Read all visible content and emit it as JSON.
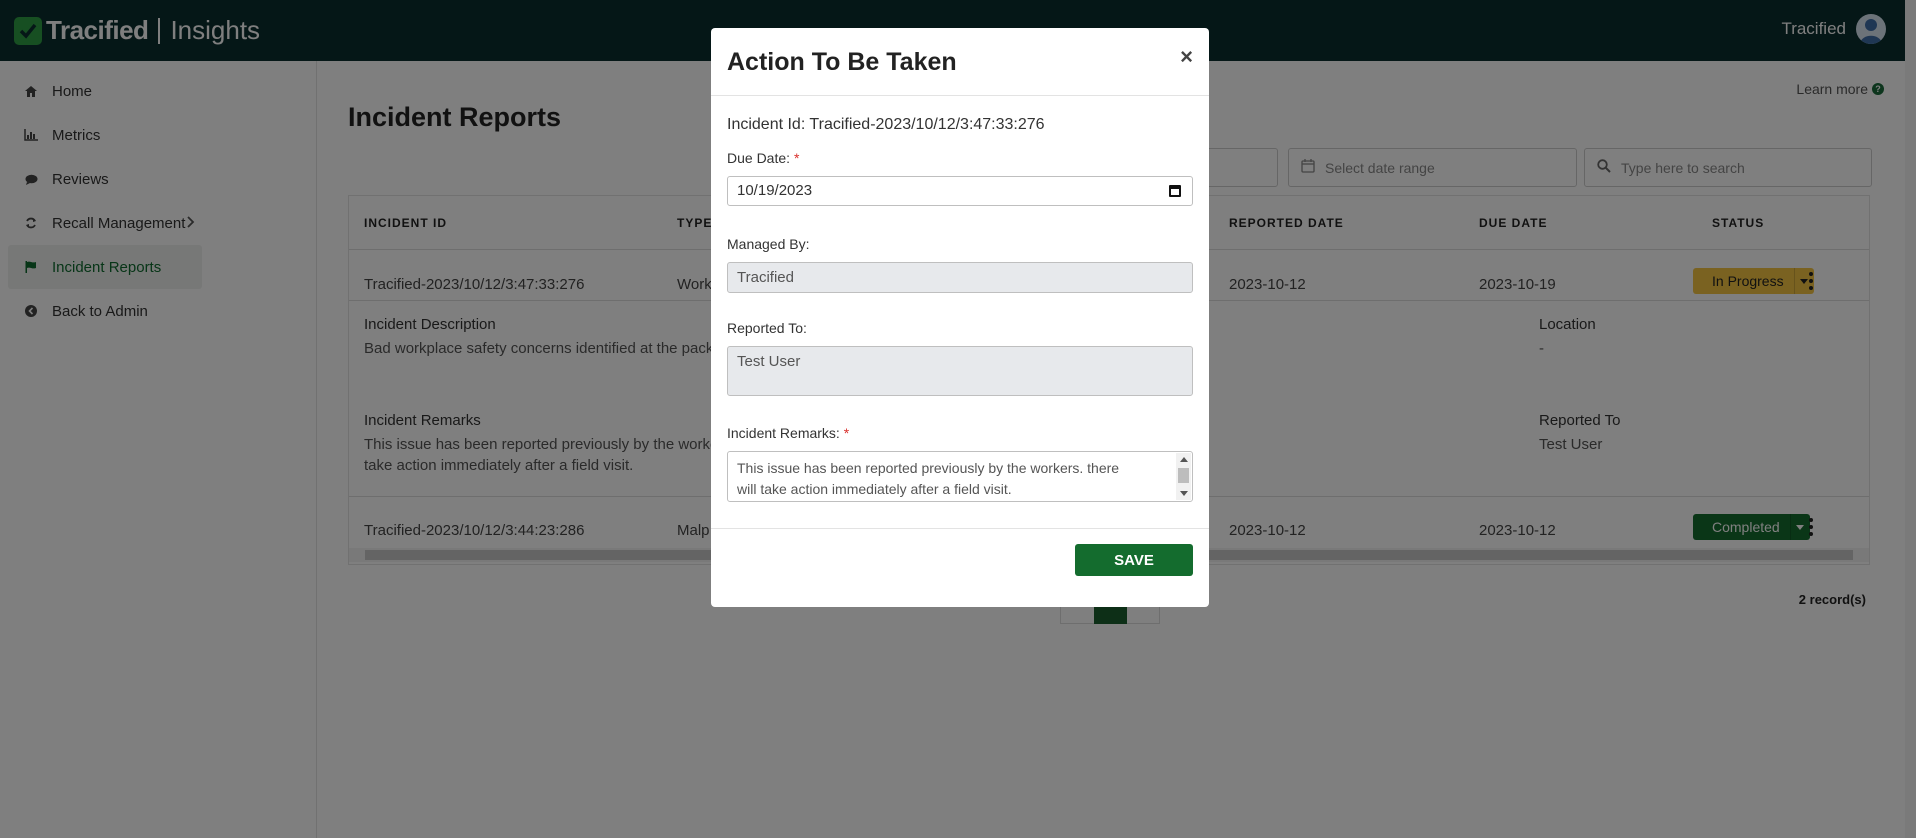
{
  "header": {
    "brand": "Tracified",
    "product": "Insights",
    "user": "Tracified"
  },
  "sidebar": {
    "items": [
      {
        "label": "Home",
        "icon": "home-icon"
      },
      {
        "label": "Metrics",
        "icon": "bar-chart-icon"
      },
      {
        "label": "Reviews",
        "icon": "comment-icon"
      },
      {
        "label": "Recall Management",
        "icon": "refresh-icon"
      },
      {
        "label": "Incident Reports",
        "icon": "flag-icon",
        "active": true
      },
      {
        "label": "Back to Admin",
        "icon": "arrow-left-circle-icon"
      }
    ]
  },
  "page": {
    "learn_more": "Learn more",
    "title": "Incident Reports",
    "date_placeholder": "Select date range",
    "search_placeholder": "Type here to search",
    "records": "2 record(s)"
  },
  "table": {
    "columns": [
      "INCIDENT ID",
      "TYPE",
      "REPORTED DATE",
      "DUE DATE",
      "STATUS"
    ],
    "rows": [
      {
        "id": "Tracified-2023/10/12/3:47:33:276",
        "type": "Work",
        "reported": "2023-10-12",
        "due": "2023-10-19",
        "status": "In Progress"
      },
      {
        "id": "Tracified-2023/10/12/3:44:23:286",
        "type": "Malp",
        "reported": "2023-10-12",
        "due": "2023-10-12",
        "status": "Completed"
      }
    ],
    "details": {
      "desc_label": "Incident Description",
      "desc_text": "Bad workplace safety concerns identified at the pack",
      "location_label": "Location",
      "location_value": "-",
      "remarks_label": "Incident Remarks",
      "remarks_text_1": "This issue has been reported previously by the worke",
      "remarks_text_2": "take action immediately after a field visit.",
      "reported_to_label": "Reported To",
      "reported_to_value": "Test User"
    }
  },
  "modal": {
    "title": "Action To Be Taken",
    "close": "×",
    "incident_id": "Incident Id: Tracified-2023/10/12/3:47:33:276",
    "due_date_label": "Due Date:",
    "due_date_value": "10/19/2023",
    "managed_by_label": "Managed By:",
    "managed_by_value": "Tracified",
    "reported_to_label": "Reported To:",
    "reported_to_value": "Test User",
    "remarks_label": "Incident Remarks:",
    "remarks_value_1": "This issue has been reported previously by the workers. there",
    "remarks_value_2": "will take action immediately after a field visit.",
    "required_mark": "*",
    "save": "SAVE"
  },
  "colors": {
    "topbar": "#0b2e2e",
    "brand_green": "#146c2e",
    "in_progress": "#f4c542",
    "completed": "#146c2e"
  }
}
